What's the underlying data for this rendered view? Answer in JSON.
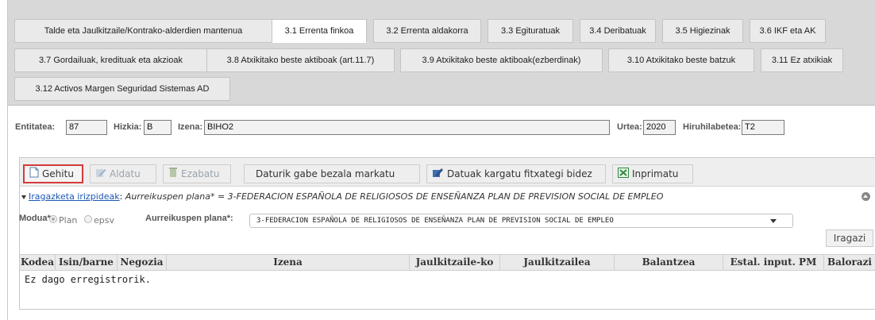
{
  "tabs": {
    "row1": [
      "Talde eta Jaulkitzaile/Kontrako-alderdien mantenua",
      "3.1 Errenta finkoa",
      "3.2 Errenta aldakorra",
      "3.3 Egituratuak",
      "3.4 Deribatuak",
      "3.5 Higiezinak",
      "3.6 IKF eta AK"
    ],
    "row2": [
      "3.7 Gordailuak, kredituak eta akzioak",
      "3.8 Atxikitako beste aktiboak (art.11.7)",
      "3.9 Atxikitako beste aktiboak(ezberdinak)",
      "3.10 Atxikitako beste batzuk",
      "3.11 Ez atxikiak"
    ],
    "row3": [
      "3.12 Activos Margen Seguridad Sistemas AD"
    ],
    "active": "3.1 Errenta finkoa"
  },
  "form": {
    "entitatea_label": "Entitatea:",
    "entitatea_value": "87",
    "hizkia_label": "Hizkia:",
    "hizkia_value": "B",
    "izena_label": "Izena:",
    "izena_value": "BIHO2",
    "urtea_label": "Urtea:",
    "urtea_value": "2020",
    "hiruhilabetea_label": "Hiruhilabetea:",
    "hiruhilabetea_value": "T2"
  },
  "toolbar": {
    "add_label": "Gehitu",
    "edit_label": "Aldatu",
    "delete_label": "Ezabatu",
    "mark_label": "Daturik gabe bezala markatu",
    "upload_label": "Datuak kargatu fitxategi bidez",
    "print_label": "Inprimatu"
  },
  "filter": {
    "link_label": "Iragazketa irizpideak",
    "summary": "Aurreikuspen plana* = 3-FEDERACION ESPAÑOLA DE RELIGIOSOS DE ENSEÑANZA PLAN DE PREVISION SOCIAL DE EMPLEO",
    "mode_label": "Modua*:",
    "mode_options": [
      "Plan",
      "epsv"
    ],
    "plan_label": "Aurreikuspen plana*:",
    "plan_value": "3-FEDERACION ESPAÑOLA DE RELIGIOSOS DE ENSEÑANZA PLAN DE PREVISION SOCIAL DE EMPLEO",
    "apply_label": "Iragazi"
  },
  "grid": {
    "columns": [
      "Kodea",
      "Isin/barne",
      "Negozia",
      "Izena",
      "Jaulkitzaile-ko",
      "Jaulkitzailea",
      "Balantzea",
      "Estal. input. PM",
      "Balorazi"
    ],
    "empty_message": "Ez dago erregistrorik."
  },
  "colors": {
    "tab_area": "#d8d8d8",
    "toolbar": "#eeeeee",
    "highlight": "#d43b3b",
    "link": "#1a57b7"
  }
}
